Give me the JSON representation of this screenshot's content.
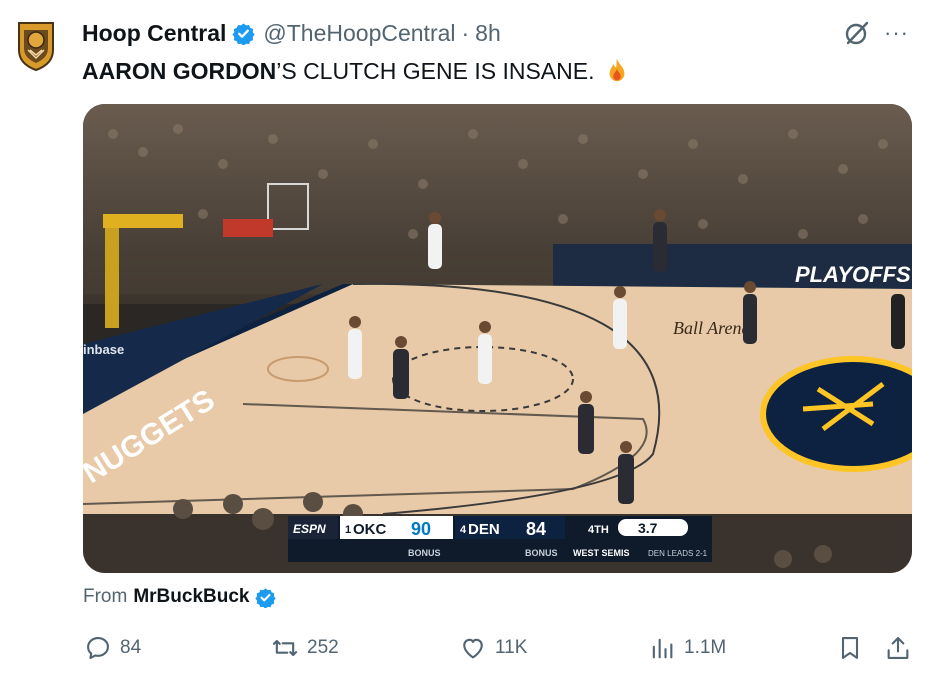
{
  "tweet": {
    "author_name": "Hoop Central",
    "author_handle": "@TheHoopCentral",
    "separator": "·",
    "time": "8h",
    "text_bold": "AARON GORDON",
    "text_rest": "’S CLUTCH GENE IS INSANE.",
    "emoji_icon": "fire-icon",
    "more_label": "···"
  },
  "media": {
    "scoreboard": {
      "network": "ESPN",
      "away_seed": "1",
      "away_team": "OKC",
      "away_score": "90",
      "home_seed": "4",
      "home_team": "DEN",
      "home_score": "84",
      "quarter": "4TH",
      "clock": "3.7",
      "away_bonus": "BONUS",
      "home_bonus": "BONUS",
      "series": "WEST SEMIS",
      "series_status": "DEN LEADS 2-1"
    },
    "arena_signs": {
      "playoffs": "PLAYOFFS",
      "coinbase": "inbase",
      "nuggets": "NUGGETS",
      "court_logo": "Ball Arena"
    }
  },
  "attribution": {
    "prefix": "From",
    "source": "MrBuckBuck"
  },
  "actions": {
    "replies": "84",
    "reposts": "252",
    "likes": "11K",
    "views": "1.1M"
  },
  "colors": {
    "verified": "#1d9bf0",
    "secondary_text": "#536471",
    "primary_text": "#0f1419",
    "nuggets_navy": "#0d2240",
    "nuggets_gold": "#fec524"
  }
}
